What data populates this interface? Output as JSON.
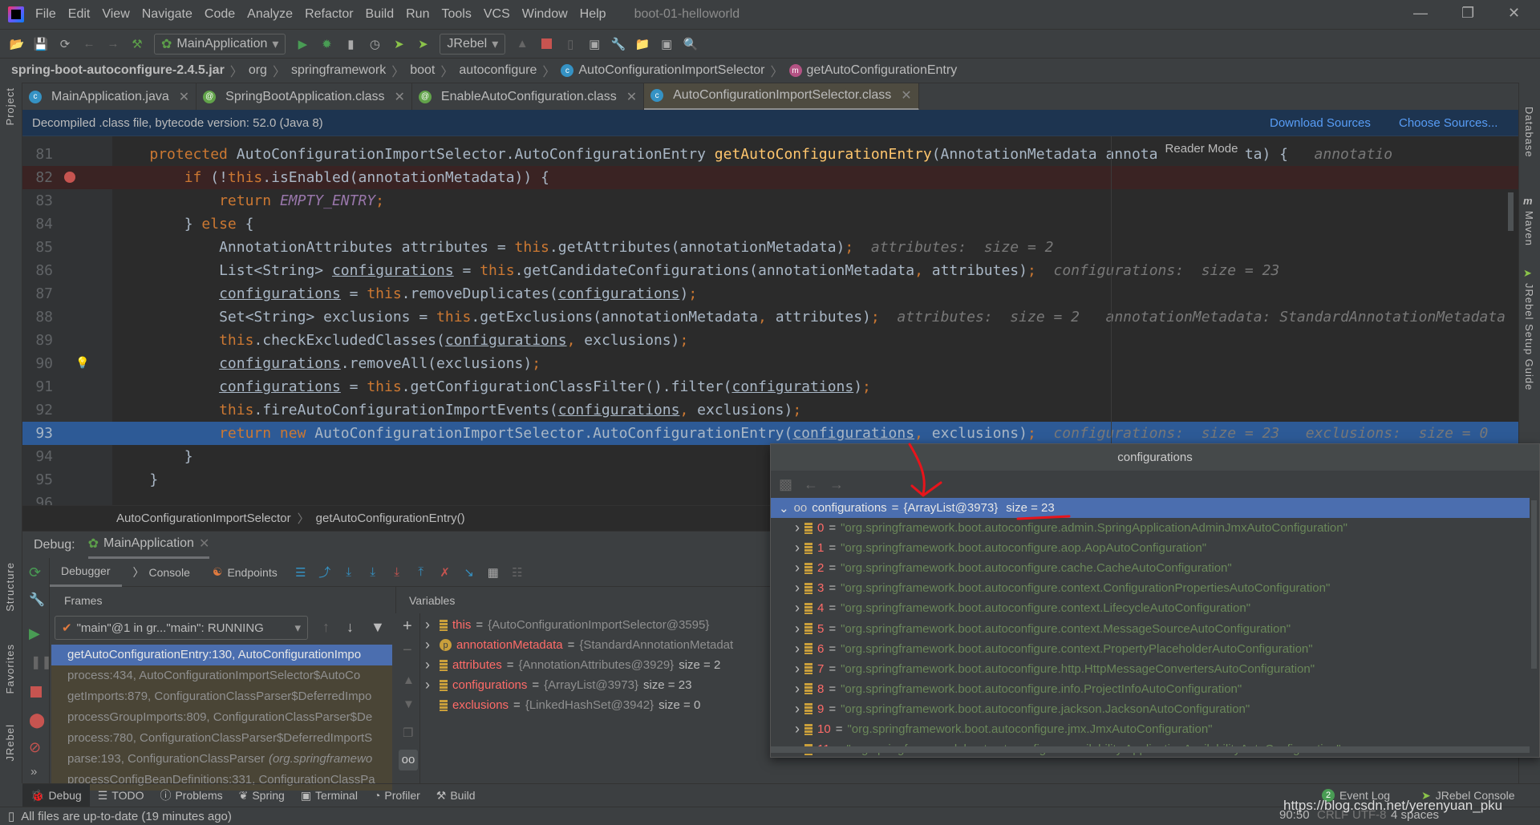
{
  "app": {
    "menu": [
      "File",
      "Edit",
      "View",
      "Navigate",
      "Code",
      "Analyze",
      "Refactor",
      "Build",
      "Run",
      "Tools",
      "VCS",
      "Window",
      "Help"
    ],
    "title": "boot-01-helloworld"
  },
  "toolbar": {
    "run_config": "MainApplication",
    "jrebel": "JRebel"
  },
  "breadcrumb": [
    "spring-boot-autoconfigure-2.4.5.jar",
    "org",
    "springframework",
    "boot",
    "autoconfigure",
    "AutoConfigurationImportSelector",
    "getAutoConfigurationEntry"
  ],
  "tabs": [
    {
      "label": "MainApplication.java",
      "icon": "c"
    },
    {
      "label": "SpringBootApplication.class",
      "icon": "@"
    },
    {
      "label": "EnableAutoConfiguration.class",
      "icon": "@"
    },
    {
      "label": "AutoConfigurationImportSelector.class",
      "icon": "c",
      "active": true
    }
  ],
  "left_strip": {
    "project": "Project",
    "structure": "Structure",
    "favorites": "Favorites",
    "jrebel": "JRebel"
  },
  "right_strip": {
    "database": "Database",
    "maven": "Maven",
    "jrebel_guide": "JRebel Setup Guide"
  },
  "banner": {
    "text": "Decompiled .class file, bytecode version: 52.0 (Java 8)",
    "download": "Download Sources",
    "choose": "Choose Sources..."
  },
  "editor": {
    "reader_mode": "Reader Mode",
    "lines": [
      {
        "num": "81",
        "indent": 4,
        "tokens": [
          [
            "protected ",
            "kw"
          ],
          [
            "AutoConfigurationImportSelector.AutoConfigurationEntry ",
            ""
          ],
          [
            "getAutoConfigurationEntry",
            "fn"
          ],
          [
            "(AnnotationMetadata annotationMetadata) {",
            ""
          ],
          [
            "   annotatio",
            "hint"
          ]
        ]
      },
      {
        "num": "82",
        "indent": 8,
        "state": "bp",
        "tokens": [
          [
            "if ",
            "kw"
          ],
          [
            "(!",
            ""
          ],
          [
            "this",
            "kw"
          ],
          [
            ".isEnabled(annotationMetadata)) {",
            ""
          ]
        ]
      },
      {
        "num": "83",
        "indent": 12,
        "tokens": [
          [
            "return ",
            "kw"
          ],
          [
            "EMPTY_ENTRY",
            "const"
          ],
          [
            ";",
            "pu"
          ]
        ]
      },
      {
        "num": "84",
        "indent": 8,
        "tokens": [
          [
            "} ",
            ""
          ],
          [
            "else ",
            "kw"
          ],
          [
            "{",
            ""
          ]
        ]
      },
      {
        "num": "85",
        "indent": 12,
        "tokens": [
          [
            "AnnotationAttributes attributes = ",
            ""
          ],
          [
            "this",
            "kw"
          ],
          [
            ".getAttributes(annotationMetadata)",
            ""
          ],
          [
            ";",
            "pu"
          ],
          [
            "  attributes:  size = 2",
            "hint"
          ]
        ]
      },
      {
        "num": "86",
        "indent": 12,
        "tokens": [
          [
            "List<String> ",
            ""
          ],
          [
            "configurations",
            "ul"
          ],
          [
            " = ",
            ""
          ],
          [
            "this",
            "kw"
          ],
          [
            ".getCandidateConfigurations(annotationMetadata",
            ""
          ],
          [
            ", ",
            "pu"
          ],
          [
            "attributes)",
            ""
          ],
          [
            ";",
            "pu"
          ],
          [
            "  configurations:  size = 23",
            "hint"
          ]
        ]
      },
      {
        "num": "87",
        "indent": 12,
        "tokens": [
          [
            "configurations",
            "ul"
          ],
          [
            " = ",
            ""
          ],
          [
            "this",
            "kw"
          ],
          [
            ".removeDuplicates(",
            ""
          ],
          [
            "configurations",
            "ul"
          ],
          [
            ")",
            ""
          ],
          [
            ";",
            "pu"
          ]
        ]
      },
      {
        "num": "88",
        "indent": 12,
        "tokens": [
          [
            "Set<String> exclusions = ",
            ""
          ],
          [
            "this",
            "kw"
          ],
          [
            ".getExclusions(annotationMetadata",
            ""
          ],
          [
            ", ",
            "pu"
          ],
          [
            "attributes)",
            ""
          ],
          [
            ";",
            "pu"
          ],
          [
            "  attributes:  size = 2   annotationMetadata: StandardAnnotationMetadata",
            "hint"
          ]
        ]
      },
      {
        "num": "89",
        "indent": 12,
        "tokens": [
          [
            "this",
            "kw"
          ],
          [
            ".checkExcludedClasses(",
            ""
          ],
          [
            "configurations",
            "ul"
          ],
          [
            ", ",
            "pu"
          ],
          [
            "exclusions)",
            ""
          ],
          [
            ";",
            "pu"
          ]
        ]
      },
      {
        "num": "90",
        "indent": 12,
        "state": "bulb",
        "tokens": [
          [
            "configurations",
            "ul"
          ],
          [
            ".removeAll(exclusions)",
            ""
          ],
          [
            ";",
            "pu"
          ]
        ]
      },
      {
        "num": "91",
        "indent": 12,
        "tokens": [
          [
            "configurations",
            "ul"
          ],
          [
            " = ",
            ""
          ],
          [
            "this",
            "kw"
          ],
          [
            ".getConfigurationClassFilter().filter(",
            ""
          ],
          [
            "configurations",
            "ul"
          ],
          [
            ")",
            ""
          ],
          [
            ";",
            "pu"
          ]
        ]
      },
      {
        "num": "92",
        "indent": 12,
        "tokens": [
          [
            "this",
            "kw"
          ],
          [
            ".fireAutoConfigurationImportEvents(",
            ""
          ],
          [
            "configurations",
            "ul"
          ],
          [
            ", ",
            "pu"
          ],
          [
            "exclusions)",
            ""
          ],
          [
            ";",
            "pu"
          ]
        ]
      },
      {
        "num": "93",
        "indent": 12,
        "state": "exec",
        "tokens": [
          [
            "return new ",
            "kw"
          ],
          [
            "AutoConfigurationImportSelector.AutoConfigurationEntry(",
            ""
          ],
          [
            "configurations",
            "ul"
          ],
          [
            ", ",
            "pu"
          ],
          [
            "exclusions)",
            ""
          ],
          [
            ";",
            "pu"
          ],
          [
            "  configurations:  size = 23   exclusions:  size = 0",
            "hint"
          ]
        ]
      },
      {
        "num": "94",
        "indent": 8,
        "tokens": [
          [
            "}",
            ""
          ]
        ]
      },
      {
        "num": "95",
        "indent": 4,
        "tokens": [
          [
            "}",
            ""
          ]
        ]
      },
      {
        "num": "96",
        "indent": 0,
        "tokens": []
      }
    ],
    "crumb_class": "AutoConfigurationImportSelector",
    "crumb_method": "getAutoConfigurationEntry()"
  },
  "debug": {
    "label": "Debug:",
    "session": "MainApplication",
    "tabs": [
      "Debugger",
      "Console",
      "Endpoints"
    ],
    "frames_title": "Frames",
    "variables_title": "Variables",
    "thread": "\"main\"@1 in gr...\"main\": RUNNING",
    "frames": [
      {
        "text": "getAutoConfigurationEntry:130, AutoConfigurationImpo",
        "selected": true
      },
      {
        "text": "process:434, AutoConfigurationImportSelector$AutoCo"
      },
      {
        "text": "getImports:879, ConfigurationClassParser$DeferredImpo"
      },
      {
        "text": "processGroupImports:809, ConfigurationClassParser$De"
      },
      {
        "text": "process:780, ConfigurationClassParser$DeferredImportS"
      },
      {
        "text": "parse:193, ConfigurationClassParser",
        "pkg": "(org.springframewo"
      },
      {
        "text": "processConfigBeanDefinitions:331, ConfigurationClassPa"
      }
    ],
    "variables": [
      {
        "name": "this",
        "value": "{AutoConfigurationImportSelector@3595}",
        "extra": "",
        "icon": "list"
      },
      {
        "name": "annotationMetadata",
        "value": "{StandardAnnotationMetadat",
        "extra": "",
        "icon": "p"
      },
      {
        "name": "attributes",
        "value": "{AnnotationAttributes@3929}",
        "extra": "size = 2",
        "icon": "list"
      },
      {
        "name": "configurations",
        "value": "{ArrayList@3973}",
        "extra": "size = 23",
        "icon": "list"
      },
      {
        "name": "exclusions",
        "value": "{LinkedHashSet@3942}",
        "extra": "size = 0",
        "icon": "list",
        "leaf": true
      }
    ]
  },
  "popup": {
    "title": "configurations",
    "root": {
      "name": "configurations",
      "value": "{ArrayList@3973}",
      "extra": "size = 23"
    },
    "items": [
      "org.springframework.boot.autoconfigure.admin.SpringApplicationAdminJmxAutoConfiguration",
      "org.springframework.boot.autoconfigure.aop.AopAutoConfiguration",
      "org.springframework.boot.autoconfigure.cache.CacheAutoConfiguration",
      "org.springframework.boot.autoconfigure.context.ConfigurationPropertiesAutoConfiguration",
      "org.springframework.boot.autoconfigure.context.LifecycleAutoConfiguration",
      "org.springframework.boot.autoconfigure.context.MessageSourceAutoConfiguration",
      "org.springframework.boot.autoconfigure.context.PropertyPlaceholderAutoConfiguration",
      "org.springframework.boot.autoconfigure.http.HttpMessageConvertersAutoConfiguration",
      "org.springframework.boot.autoconfigure.info.ProjectInfoAutoConfiguration",
      "org.springframework.boot.autoconfigure.jackson.JacksonAutoConfiguration",
      "org.springframework.boot.autoconfigure.jmx.JmxAutoConfiguration",
      "org.springframework.boot.autoconfigure.availability.ApplicationAvailabilityAutoConfiguration"
    ],
    "annotation_color": "#e8141b"
  },
  "bottom": {
    "tools": [
      "Debug",
      "TODO",
      "Problems",
      "Spring",
      "Terminal",
      "Profiler",
      "Build"
    ],
    "event_count": "2",
    "event_log": "Event Log",
    "jrebel_console": "JRebel Console"
  },
  "status": {
    "message": "All files are up-to-date (19 minutes ago)",
    "position": "90:50",
    "line_sep": "CRLF",
    "encoding": "UTF-8",
    "indent": "4 spaces",
    "watermark": "https://blog.csdn.net/yerenyuan_pku"
  }
}
